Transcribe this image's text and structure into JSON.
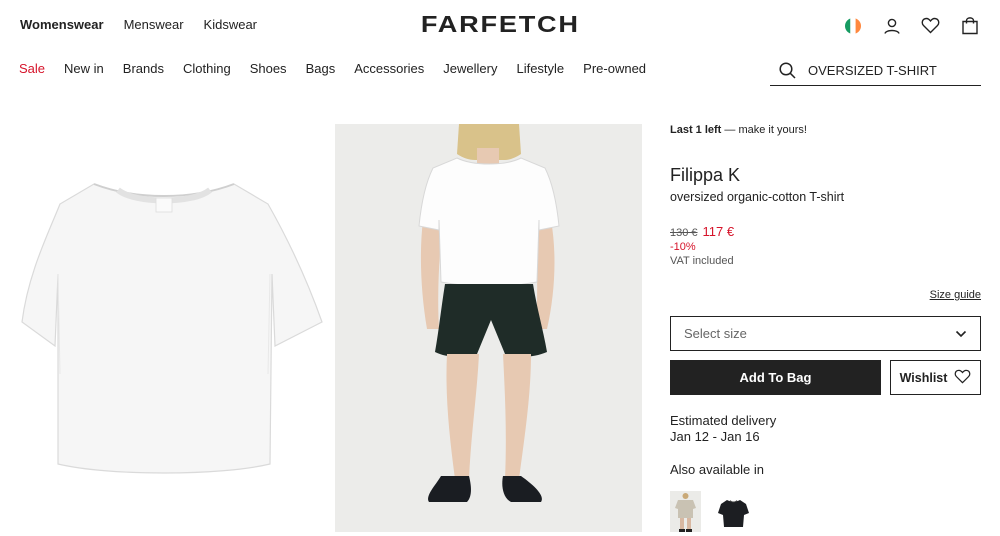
{
  "header": {
    "gender_nav": [
      "Womenswear",
      "Menswear",
      "Kidswear"
    ],
    "logo": "FARFETCH"
  },
  "categories": [
    "Sale",
    "New in",
    "Brands",
    "Clothing",
    "Shoes",
    "Bags",
    "Accessories",
    "Jewellery",
    "Lifestyle",
    "Pre-owned"
  ],
  "search": {
    "value": "OVERSIZED T-SHIRT"
  },
  "product": {
    "stock_bold": "Last 1 left",
    "stock_rest": " — make it yours!",
    "brand": "Filippa K",
    "description": "oversized organic-cotton T-shirt",
    "old_price": "130 €",
    "price": "117 €",
    "discount": "-10%",
    "vat": "VAT included",
    "size_guide": "Size guide",
    "size_placeholder": "Select size",
    "add_to_bag": "Add To Bag",
    "wishlist": "Wishlist",
    "delivery_label": "Estimated delivery",
    "delivery_dates": "Jan 12 - Jan 16",
    "also_available": "Also available in"
  },
  "colors": {
    "sale_red": "#d6132a",
    "primary_dark": "#222222",
    "flag": [
      "#169b62",
      "#ffffff",
      "#ff883e"
    ]
  }
}
